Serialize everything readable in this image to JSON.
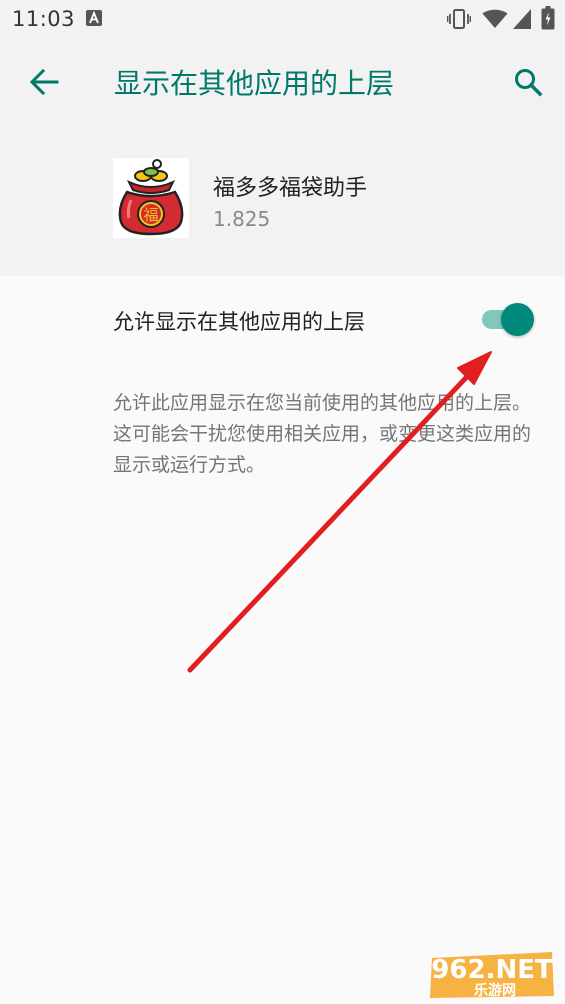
{
  "status_bar": {
    "time": "11:03",
    "notification_icon": "a-icon",
    "icons": [
      "vibrate-icon",
      "wifi-icon",
      "signal-icon",
      "battery-icon"
    ]
  },
  "app_bar": {
    "title": "显示在其他应用的上层",
    "back_icon": "arrow-back-icon",
    "search_icon": "search-icon",
    "accent_color": "#00796b"
  },
  "app_info": {
    "name": "福多多福袋助手",
    "version": "1.825",
    "icon_text": "福"
  },
  "setting": {
    "label": "允许显示在其他应用的上层",
    "enabled": true,
    "description": "允许此应用显示在您当前使用的其他应用的上层。这可能会干扰您使用相关应用，或变更这类应用的显示或运行方式。"
  },
  "annotation": {
    "type": "red-arrow",
    "color": "#e02020"
  },
  "watermark": {
    "brand": "962.NET",
    "subtitle": "乐游网"
  }
}
